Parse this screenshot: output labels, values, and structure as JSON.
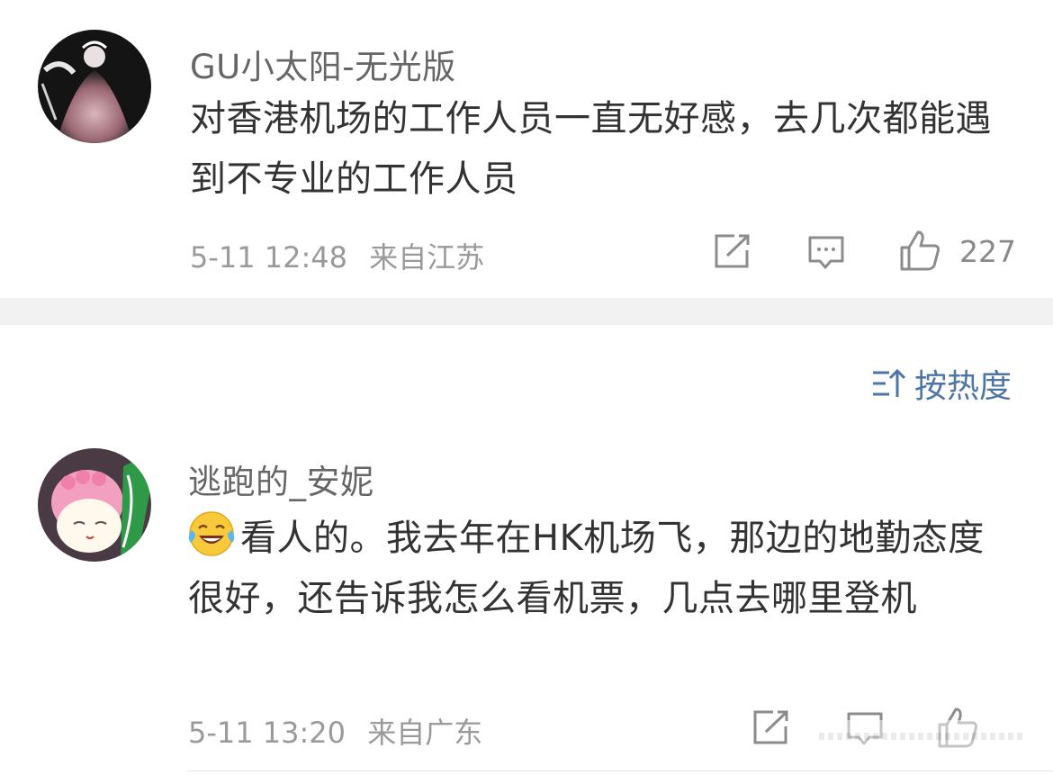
{
  "comments": [
    {
      "username": "GU小太阳-无光版",
      "text": "对香港机场的工作人员一直无好感，去几次都能遇到不专业的工作人员",
      "time": "5-11 12:48",
      "location": "来自江苏",
      "likes": "227",
      "emoji": ""
    },
    {
      "username": "逃跑的_安妮",
      "emoji": "laughing-tears",
      "text": "看人的。我去年在HK机场飞，那边的地勤态度很好，还告诉我怎么看机票，几点去哪里登机",
      "time": "5-11 13:20",
      "location": "来自广东",
      "likes": ""
    }
  ],
  "sort": {
    "label": "按热度",
    "icon": "sort-icon"
  },
  "icons": {
    "share": "share-icon",
    "comment": "comment-icon",
    "like": "thumbs-up-icon"
  },
  "colors": {
    "link_blue": "#4f74a6",
    "text_main": "#333333",
    "text_meta": "#9a9a9a",
    "separator": "#f2f2f2"
  }
}
